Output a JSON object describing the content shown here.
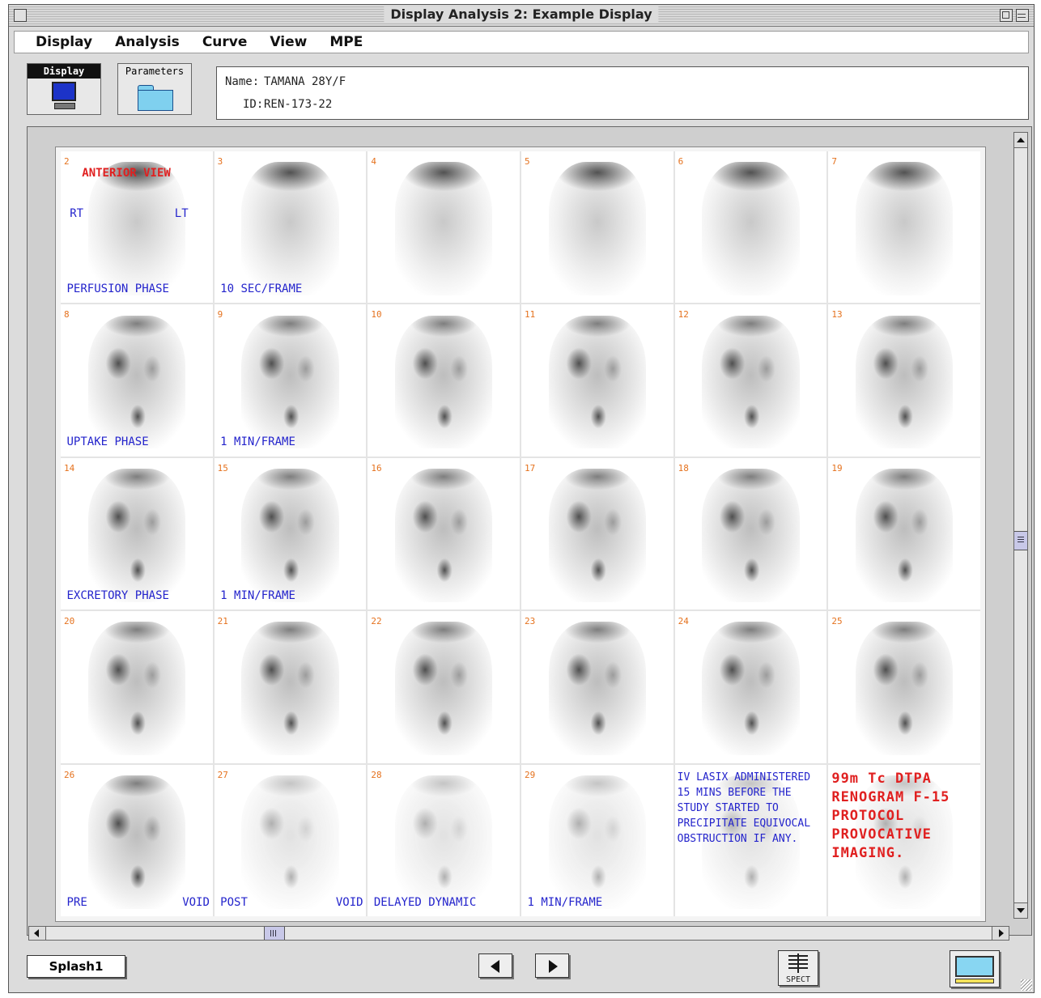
{
  "window": {
    "title": "Display Analysis 2: Example Display"
  },
  "menu": {
    "items": [
      "Display",
      "Analysis",
      "Curve",
      "View",
      "MPE"
    ]
  },
  "toolbar": {
    "display_label": "Display",
    "parameters_label": "Parameters"
  },
  "patient": {
    "name_label": "Name:",
    "name_value": "TAMANA 28Y/F",
    "id_label": "ID:",
    "id_value": "REN-173-22"
  },
  "frames": [
    {
      "num": "2",
      "labels": [
        {
          "text": "ANTERIOR VIEW",
          "color": "red",
          "pos": "top-center"
        },
        {
          "text": "RT",
          "color": "blue",
          "pos": "mid-left"
        },
        {
          "text": "LT",
          "color": "blue",
          "pos": "mid-right"
        },
        {
          "text": "PERFUSION PHASE",
          "color": "blue",
          "pos": "bottom-left"
        }
      ],
      "style": "early"
    },
    {
      "num": "3",
      "labels": [
        {
          "text": "10 SEC/FRAME",
          "color": "blue",
          "pos": "bottom-left"
        }
      ],
      "style": "early"
    },
    {
      "num": "4",
      "labels": [],
      "style": "early"
    },
    {
      "num": "5",
      "labels": [],
      "style": "early"
    },
    {
      "num": "6",
      "labels": [],
      "style": "early"
    },
    {
      "num": "7",
      "labels": [],
      "style": "early"
    },
    {
      "num": "8",
      "labels": [
        {
          "text": "UPTAKE PHASE",
          "color": "blue",
          "pos": "bottom-left"
        }
      ],
      "style": "normal"
    },
    {
      "num": "9",
      "labels": [
        {
          "text": "1 MIN/FRAME",
          "color": "blue",
          "pos": "bottom-left"
        }
      ],
      "style": "normal"
    },
    {
      "num": "10",
      "labels": [],
      "style": "normal"
    },
    {
      "num": "11",
      "labels": [],
      "style": "normal"
    },
    {
      "num": "12",
      "labels": [],
      "style": "normal"
    },
    {
      "num": "13",
      "labels": [],
      "style": "normal"
    },
    {
      "num": "14",
      "labels": [
        {
          "text": "EXCRETORY PHASE",
          "color": "blue",
          "pos": "bottom-left"
        }
      ],
      "style": "normal"
    },
    {
      "num": "15",
      "labels": [
        {
          "text": "1 MIN/FRAME",
          "color": "blue",
          "pos": "bottom-left"
        }
      ],
      "style": "normal"
    },
    {
      "num": "16",
      "labels": [],
      "style": "normal"
    },
    {
      "num": "17",
      "labels": [],
      "style": "normal"
    },
    {
      "num": "18",
      "labels": [],
      "style": "normal"
    },
    {
      "num": "19",
      "labels": [],
      "style": "normal"
    },
    {
      "num": "20",
      "labels": [],
      "style": "normal"
    },
    {
      "num": "21",
      "labels": [],
      "style": "normal"
    },
    {
      "num": "22",
      "labels": [],
      "style": "normal"
    },
    {
      "num": "23",
      "labels": [],
      "style": "normal"
    },
    {
      "num": "24",
      "labels": [],
      "style": "normal"
    },
    {
      "num": "25",
      "labels": [],
      "style": "normal"
    },
    {
      "num": "26",
      "labels": [
        {
          "text": "PRE",
          "color": "blue",
          "pos": "bottom-left"
        },
        {
          "text": "VOID",
          "color": "blue",
          "pos": "bottom-right"
        }
      ],
      "style": "normal"
    },
    {
      "num": "27",
      "labels": [
        {
          "text": "POST",
          "color": "blue",
          "pos": "bottom-left"
        },
        {
          "text": "VOID",
          "color": "blue",
          "pos": "bottom-right"
        }
      ],
      "style": "faint"
    },
    {
      "num": "28",
      "labels": [
        {
          "text": "DELAYED DYNAMIC",
          "color": "blue",
          "pos": "bottom-left"
        }
      ],
      "style": "faint"
    },
    {
      "num": "29",
      "labels": [
        {
          "text": "1 MIN/FRAME",
          "color": "blue",
          "pos": "bottom-left"
        }
      ],
      "style": "faint"
    },
    {
      "num": "",
      "note": "IV LASIX ADMINISTERED 15 MINS BEFORE THE STUDY STARTED TO PRECIPITATE EQUIVOCAL OBSTRUCTION IF ANY.",
      "note_color": "blue",
      "style": "faint"
    },
    {
      "num": "",
      "note": "99m Tc DTPA RENOGRAM F-15 PROTOCOL PROVOCATIVE IMAGING.",
      "note_color": "red",
      "style": "faint"
    }
  ],
  "bottom": {
    "splash_label": "Splash1",
    "spect_label": "SPECT"
  }
}
